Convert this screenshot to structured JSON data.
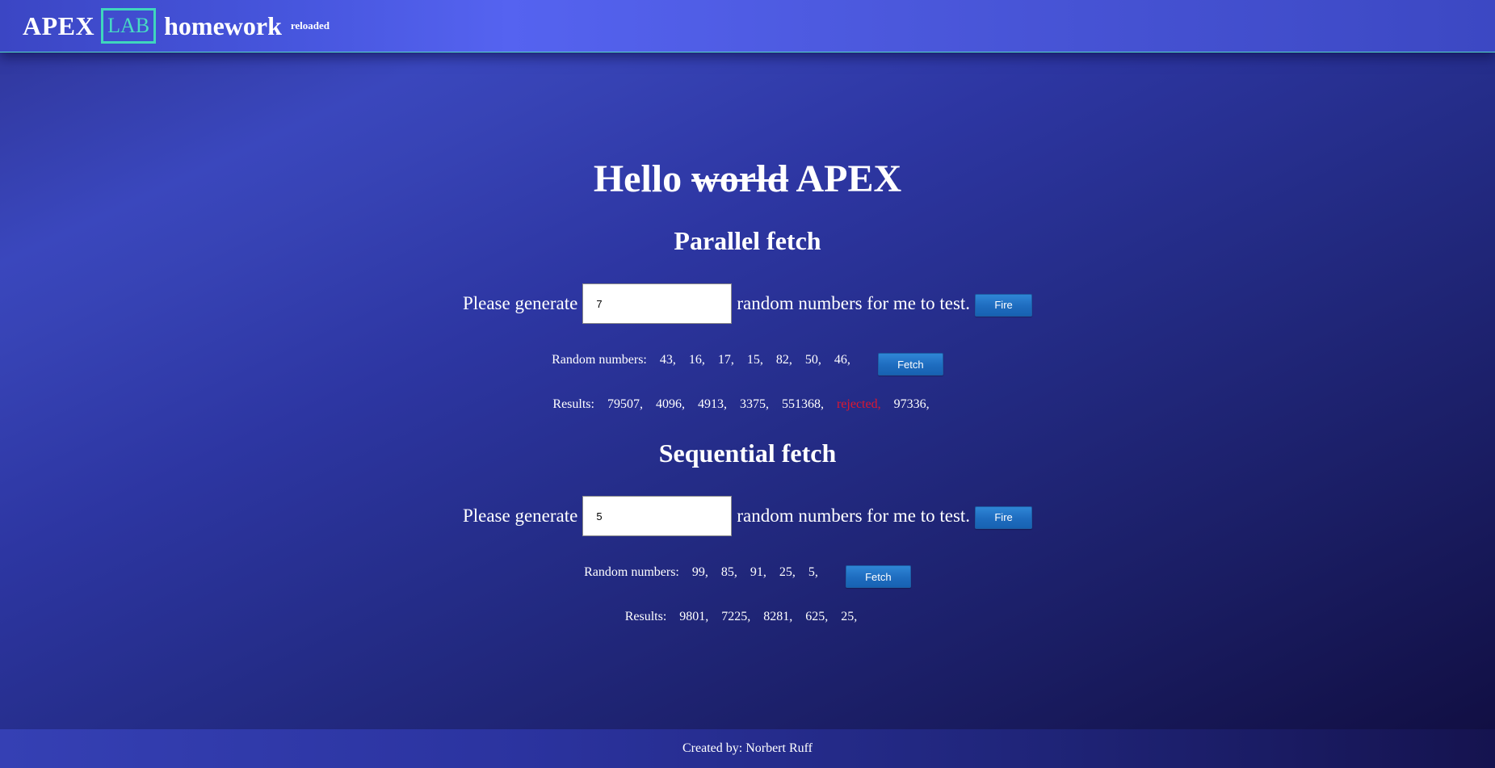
{
  "header": {
    "brand_apex": "APEX",
    "brand_lab": "LAB",
    "brand_homework": "homework",
    "brand_reloaded": "reloaded"
  },
  "hello": {
    "hello": "Hello",
    "struck": "world",
    "apex": "APEX"
  },
  "parallel": {
    "title": "Parallel fetch",
    "prompt_before": "Please generate",
    "input_value": "7",
    "prompt_after": "random numbers for me to test.",
    "fire_label": "Fire",
    "random_label": "Random numbers:",
    "random_numbers": [
      "43,",
      "16,",
      "17,",
      "15,",
      "82,",
      "50,",
      "46,"
    ],
    "fetch_label": "Fetch",
    "results_label": "Results:",
    "results": [
      {
        "text": "79507,",
        "rejected": false
      },
      {
        "text": "4096,",
        "rejected": false
      },
      {
        "text": "4913,",
        "rejected": false
      },
      {
        "text": "3375,",
        "rejected": false
      },
      {
        "text": "551368,",
        "rejected": false
      },
      {
        "text": "rejected,",
        "rejected": true
      },
      {
        "text": "97336,",
        "rejected": false
      }
    ]
  },
  "sequential": {
    "title": "Sequential fetch",
    "prompt_before": "Please generate",
    "input_value": "5",
    "prompt_after": "random numbers for me to test.",
    "fire_label": "Fire",
    "random_label": "Random numbers:",
    "random_numbers": [
      "99,",
      "85,",
      "91,",
      "25,",
      "5,"
    ],
    "fetch_label": "Fetch",
    "results_label": "Results:",
    "results": [
      {
        "text": "9801,",
        "rejected": false
      },
      {
        "text": "7225,",
        "rejected": false
      },
      {
        "text": "8281,",
        "rejected": false
      },
      {
        "text": "625,",
        "rejected": false
      },
      {
        "text": "25,",
        "rejected": false
      }
    ]
  },
  "footer": {
    "credit": "Created by: Norbert Ruff"
  },
  "colors": {
    "accent": "#3fd6bd",
    "rejected": "#e0172f",
    "button": "#1e6cbf"
  }
}
